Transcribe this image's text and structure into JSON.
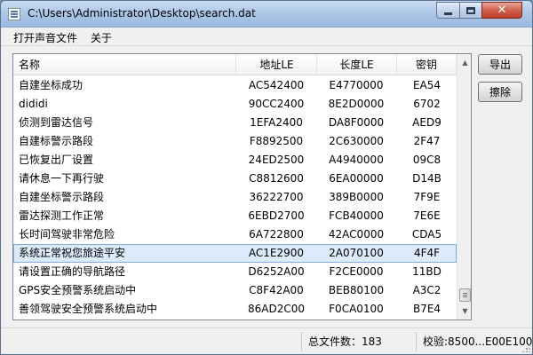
{
  "window": {
    "title": "C:\\Users\\Administrator\\Desktop\\search.dat"
  },
  "menu": {
    "items": [
      "打开声音文件",
      "关于"
    ]
  },
  "table": {
    "columns": [
      "名称",
      "地址LE",
      "长度LE",
      "密钥"
    ],
    "selected_row": 9,
    "rows": [
      {
        "name": "自建坐标成功",
        "addr": "AC542400",
        "len": "E4770000",
        "key": "EA54"
      },
      {
        "name": "dididi",
        "addr": "90CC2400",
        "len": "8E2D0000",
        "key": "6702"
      },
      {
        "name": "侦测到雷达信号",
        "addr": "1EFA2400",
        "len": "DA8F0000",
        "key": "AED9"
      },
      {
        "name": "自建标警示路段",
        "addr": "F8892500",
        "len": "2C630000",
        "key": "2F47"
      },
      {
        "name": "已恢复出厂设置",
        "addr": "24ED2500",
        "len": "A4940000",
        "key": "09C8"
      },
      {
        "name": "请休息一下再行驶",
        "addr": "C8812600",
        "len": "6EA00000",
        "key": "D14B"
      },
      {
        "name": "自建坐标警示路段",
        "addr": "36222700",
        "len": "389B0000",
        "key": "7F9E"
      },
      {
        "name": "雷达探测工作正常",
        "addr": "6EBD2700",
        "len": "FCB40000",
        "key": "7E6E"
      },
      {
        "name": "长时间驾驶非常危险",
        "addr": "6A722800",
        "len": "42AC0000",
        "key": "CDA5"
      },
      {
        "name": "系统正常祝您旅途平安",
        "addr": "AC1E2900",
        "len": "2A070100",
        "key": "4F4F"
      },
      {
        "name": "请设置正确的导航路径",
        "addr": "D6252A00",
        "len": "F2CE0000",
        "key": "11BD"
      },
      {
        "name": "GPS安全预警系统启动中",
        "addr": "C8F42A00",
        "len": "BEB80100",
        "key": "A3C2"
      },
      {
        "name": "善领驾驶安全预警系统启动中",
        "addr": "86AD2C00",
        "len": "F0CA0100",
        "key": "B7E4"
      }
    ]
  },
  "buttons": {
    "export": "导出",
    "remove": "擦除"
  },
  "status": {
    "file_count": "总文件数：183",
    "checksum": "校验:8500...E00E100"
  },
  "icons": {
    "app": "document-list-icon",
    "minimize": "minimize-icon",
    "maximize": "maximize-icon",
    "close": "close-icon",
    "scroll_up": "arrow-up-icon",
    "scroll_down": "arrow-down-icon",
    "grip": "resize-grip-icon"
  },
  "colors": {
    "selection": "#dcebfc",
    "selection_border": "#84acdd",
    "close_button": "#d0604c"
  }
}
